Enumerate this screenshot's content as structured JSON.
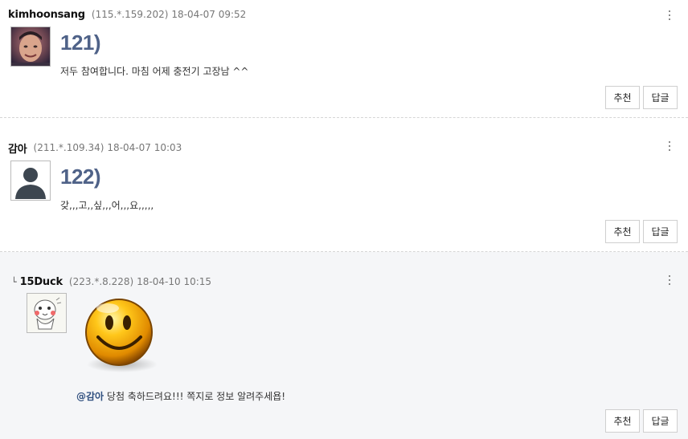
{
  "comments": [
    {
      "author": "kimhoonsang",
      "ip": "(115.*.159.202)",
      "date": "18-04-07 09:52",
      "number": "121)",
      "text": "저두 참여합니다. 마침 어제 충전기 고장남 ^^",
      "avatar": "user-photo"
    },
    {
      "author": "감아",
      "ip": "(211.*.109.34)",
      "date": "18-04-07 10:03",
      "number": "122)",
      "text": "갖,,,고,,싶,,,어,,,요,,,,,",
      "avatar": "default-user-silhouette"
    },
    {
      "reply_mark": "└",
      "author": "15Duck",
      "ip": "(223.*.8.228)",
      "date": "18-04-10 10:15",
      "mention": "@감아",
      "text": " 당첨 축하드려요!!! 쪽지로 정보 알려주세욥!",
      "avatar": "cartoon-character",
      "emoticon": "smiley-emoticon"
    }
  ],
  "buttons": {
    "recommend": "추천",
    "reply": "답글"
  },
  "icons": {
    "more": "kebab-menu-icon"
  },
  "colors": {
    "number": "#4f6288",
    "mention": "#2f4f7f",
    "reply_bg": "#f5f6f8",
    "divider": "#d6d6d6"
  }
}
